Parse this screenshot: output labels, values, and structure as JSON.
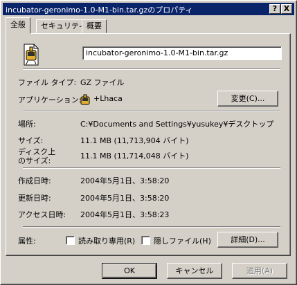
{
  "window": {
    "title": "incubator-geronimo-1.0-M1-bin.tar.gzのプロパティ",
    "help_glyph": "?",
    "close_glyph": "X"
  },
  "tabs": [
    {
      "label": "全般",
      "active": true
    },
    {
      "label": "セキュリティ",
      "active": false
    },
    {
      "label": "概要",
      "active": false
    }
  ],
  "general": {
    "file_name": "incubator-geronimo-1.0-M1-bin.tar.gz",
    "file_type_label": "ファイル タイプ:",
    "file_type_value": "GZ ファイル",
    "application_label": "アプリケーション:",
    "application_value": "+Lhaca",
    "change_button": "変更(C)...",
    "location_label": "場所:",
    "location_value": "C:¥Documents and Settings¥yusukey¥デスクトップ",
    "size_label": "サイズ:",
    "size_value": "11.1 MB (11,713,904 バイト)",
    "disk_size_label_line1": "ディスク上",
    "disk_size_label_line2": "のサイズ:",
    "disk_size_value": "11.1 MB (11,714,048 バイト)",
    "created_label": "作成日時:",
    "created_value": "2004年5月1日、3:58:20",
    "modified_label": "更新日時:",
    "modified_value": "2004年5月1日、3:58:20",
    "accessed_label": "アクセス日時:",
    "accessed_value": "2004年5月1日、3:58:23",
    "attributes_label": "属性:",
    "readonly_label": "読み取り専用(R)",
    "readonly_checked": false,
    "hidden_label": "隠しファイル(H)",
    "hidden_checked": false,
    "advanced_button": "詳細(D)..."
  },
  "footer": {
    "ok": "OK",
    "cancel": "キャンセル",
    "apply": "適用(A)"
  },
  "colors": {
    "titlebar": "#0a246a",
    "face": "#d4d0c8"
  },
  "icons": {
    "file": "lhaca-archive-icon",
    "app": "lhaca-app-icon"
  }
}
